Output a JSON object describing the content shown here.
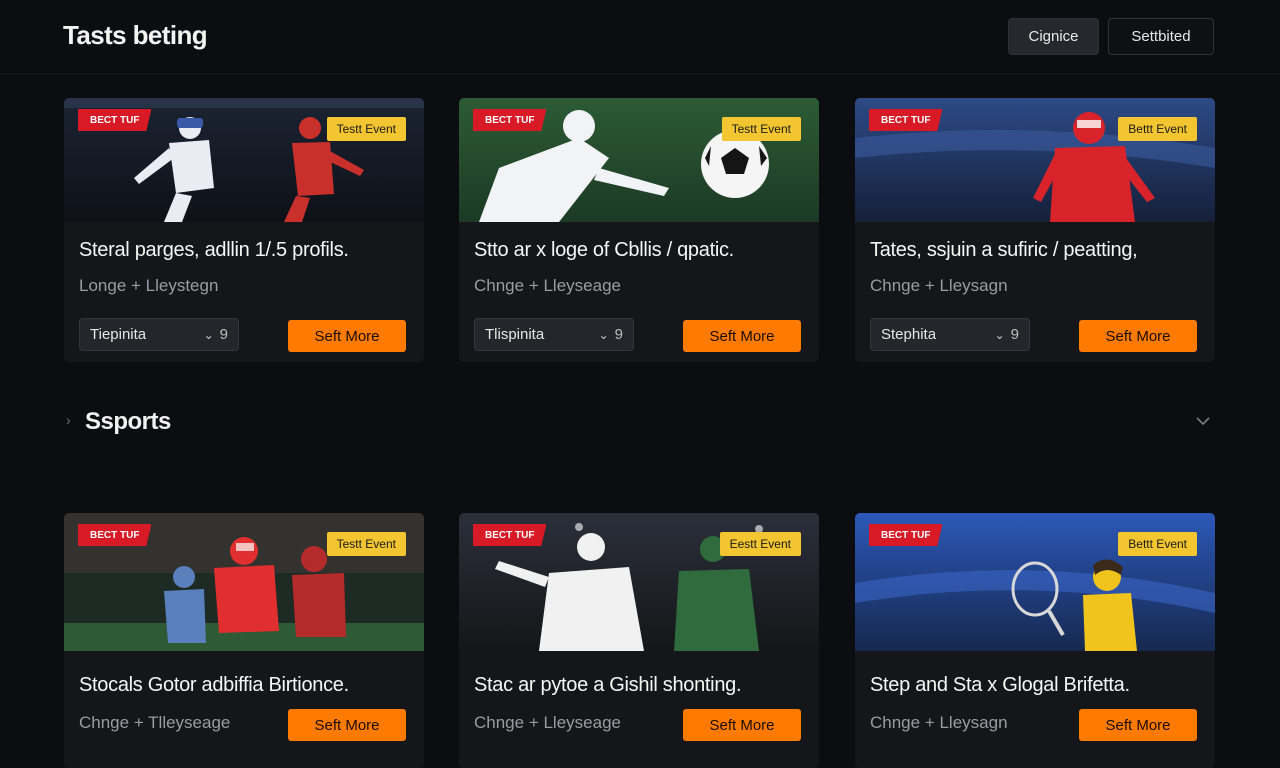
{
  "header": {
    "title": "Tasts beting",
    "primary_button": "Cignice",
    "secondary_button": "Settbited"
  },
  "section": {
    "title": "Ssports"
  },
  "cards": [
    {
      "badge": "BECT TUF",
      "tag": "Testt Event",
      "title": "Steral parges, adllin 1/.5 profils.",
      "subtitle": "Longe + Lleystegn",
      "select_value": "Tiepinita",
      "select_num": "9",
      "cta": "Seft More",
      "scene": "football-night",
      "jersey_a": "#e9ecf3",
      "jersey_b": "#c9302c"
    },
    {
      "badge": "BECT TUF",
      "tag": "Testt Event",
      "title": "Stto ar x loge of Cbllis / qpatic.",
      "subtitle": "Chnge + Lleyseage",
      "select_value": "Tlispinita",
      "select_num": "9",
      "cta": "Seft More",
      "scene": "soccer-day",
      "jersey_a": "#f1f3f6",
      "jersey_b": "#3f7a3f"
    },
    {
      "badge": "BECT TUF",
      "tag": "Bettt Event",
      "title": "Tates, ssjuin a sufiric / peatting,",
      "subtitle": "Chnge + Lleysagn",
      "select_value": "Stephita",
      "select_num": "9",
      "cta": "Seft More",
      "scene": "stadium-blue",
      "jersey_a": "#d9232a",
      "jersey_b": "#d9232a"
    },
    {
      "badge": "BECT TUF",
      "tag": "Testt Event",
      "title": "Stocals Gotor adbiffia Birtionce.",
      "subtitle": "Chnge + Tlleyseage",
      "cta": "Seft More",
      "scene": "american-football",
      "jersey_a": "#e12f2f",
      "jersey_b": "#b52a2a"
    },
    {
      "badge": "BECT TUF",
      "tag": "Eestt Event",
      "title": "Stac ar pytoe a Gishil shonting.",
      "subtitle": "Chnge + Lleyseage",
      "cta": "Seft More",
      "scene": "soccer-night",
      "jersey_a": "#f1f1f1",
      "jersey_b": "#2f6b3c"
    },
    {
      "badge": "BECT TUF",
      "tag": "Bettt Event",
      "title": "Step and Sta x Glogal Brifetta.",
      "subtitle": "Chnge + Lleysagn",
      "cta": "Seft More",
      "scene": "tennis",
      "jersey_a": "#f0c31d",
      "jersey_b": "#f0c31d"
    }
  ],
  "colors": {
    "background": "#0c0d10",
    "card": "#14161a",
    "accent_orange": "#ff7a00",
    "badge_red": "#d71a25",
    "badge_yellow": "#f2c531"
  }
}
